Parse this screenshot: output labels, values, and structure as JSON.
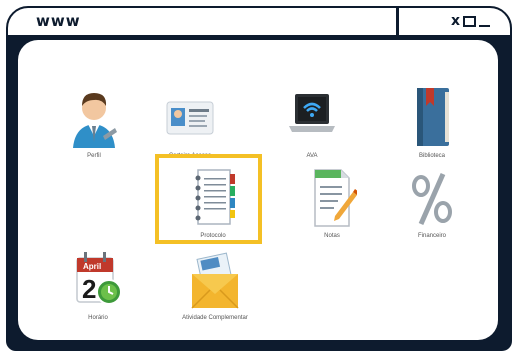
{
  "window": {
    "title": "www",
    "controls": {
      "close": "x",
      "maximize": "□",
      "minimize": "_"
    }
  },
  "apps": [
    {
      "id": "perfil",
      "label": "Perfil",
      "icon": "user-avatar-icon"
    },
    {
      "id": "carteira",
      "label": "Carteira Acesso",
      "icon": "id-card-icon"
    },
    {
      "id": "ava",
      "label": "AVA",
      "icon": "laptop-wifi-icon"
    },
    {
      "id": "biblioteca",
      "label": "Biblioteca",
      "icon": "book-icon"
    },
    {
      "id": "protocolo",
      "label": "Protocolo",
      "icon": "notebook-icon",
      "highlighted": true
    },
    {
      "id": "notas",
      "label": "Notas",
      "icon": "document-pencil-icon"
    },
    {
      "id": "financeiro",
      "label": "Financeiro",
      "icon": "percent-icon"
    },
    {
      "id": "horario",
      "label": "Horário",
      "icon": "calendar-clock-icon",
      "calendar_month": "April",
      "calendar_day": "2"
    },
    {
      "id": "atividade",
      "label": "Atividade Complementar",
      "icon": "envelope-icon"
    }
  ],
  "colors": {
    "frame": "#0d1b2e",
    "highlight": "#f4c025"
  }
}
